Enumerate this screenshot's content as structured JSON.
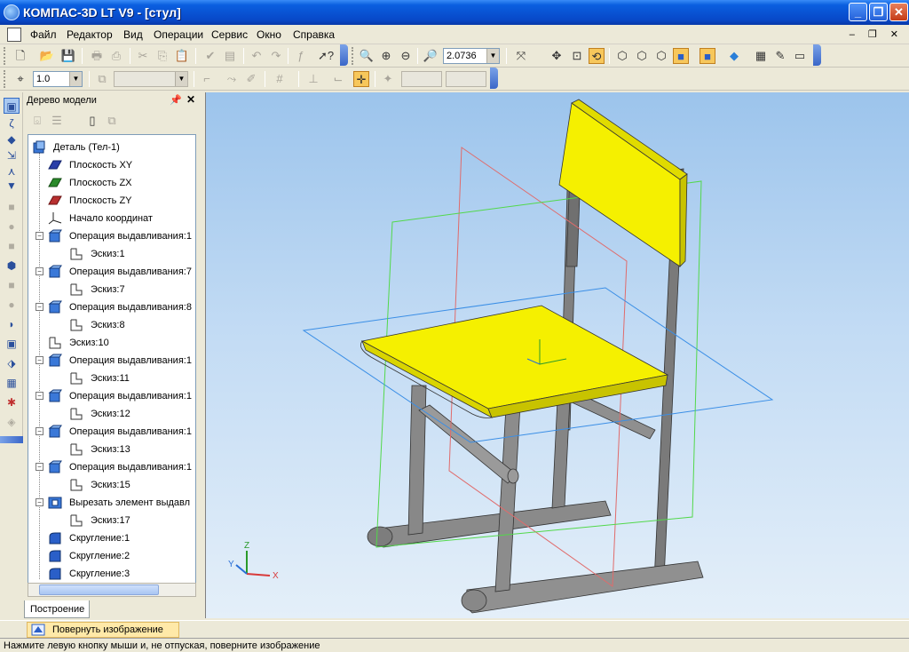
{
  "window": {
    "title": "КОМПАС-3D LT V9 - [стул]",
    "minimize": "_",
    "maximize": "❐",
    "close": "✕"
  },
  "menu": {
    "items": [
      "Файл",
      "Редактор",
      "Вид",
      "Операции",
      "Сервис",
      "Окно",
      "Справка"
    ],
    "mdi_buttons": "– ❐ ✕"
  },
  "toolbar1": {
    "zoom_value": "2.0736"
  },
  "toolbar2": {
    "step_value": "1.0"
  },
  "model_tree": {
    "title": "Дерево модели",
    "pin_icon": "pin-icon",
    "close": "✕",
    "items": [
      {
        "label": "Деталь (Тел-1)",
        "icon": "part-icon"
      },
      {
        "label": "Плоскость XY",
        "icon": "plane-xy-icon"
      },
      {
        "label": "Плоскость ZX",
        "icon": "plane-zx-icon"
      },
      {
        "label": "Плоскость ZY",
        "icon": "plane-zy-icon"
      },
      {
        "label": "Начало координат",
        "icon": "origin-icon"
      },
      {
        "label": "Операция выдавливания:1",
        "icon": "extrude-icon"
      },
      {
        "label": "Эскиз:1",
        "icon": "sketch-icon"
      },
      {
        "label": "Операция выдавливания:7",
        "icon": "extrude-icon"
      },
      {
        "label": "Эскиз:7",
        "icon": "sketch-icon"
      },
      {
        "label": "Операция выдавливания:8",
        "icon": "extrude-icon"
      },
      {
        "label": "Эскиз:8",
        "icon": "sketch-icon"
      },
      {
        "label": "Эскиз:10",
        "icon": "sketch-icon"
      },
      {
        "label": "Операция выдавливания:1",
        "icon": "extrude-icon"
      },
      {
        "label": "Эскиз:11",
        "icon": "sketch-icon"
      },
      {
        "label": "Операция выдавливания:1",
        "icon": "extrude-icon"
      },
      {
        "label": "Эскиз:12",
        "icon": "sketch-icon"
      },
      {
        "label": "Операция выдавливания:1",
        "icon": "extrude-icon"
      },
      {
        "label": "Эскиз:13",
        "icon": "sketch-icon"
      },
      {
        "label": "Операция выдавливания:1",
        "icon": "extrude-icon"
      },
      {
        "label": "Эскиз:15",
        "icon": "sketch-icon"
      },
      {
        "label": "Вырезать элемент выдавл",
        "icon": "cut-extrude-icon"
      },
      {
        "label": "Эскиз:17",
        "icon": "sketch-icon"
      },
      {
        "label": "Скругление:1",
        "icon": "fillet-icon"
      },
      {
        "label": "Скругление:2",
        "icon": "fillet-icon"
      },
      {
        "label": "Скругление:3",
        "icon": "fillet-icon"
      }
    ],
    "tab": "Построение"
  },
  "viewport": {
    "axis_labels": {
      "x": "X",
      "y": "Y",
      "z": "Z"
    }
  },
  "hint": {
    "label": "Повернуть изображение"
  },
  "status": {
    "text": "Нажмите левую кнопку мыши и, не отпуская, поверните изображение"
  },
  "colors": {
    "seat": "#f5f000",
    "frame": "#7f7f7f",
    "plane_xy": "#3a8ee6",
    "plane_zx": "#52d84a",
    "plane_zy": "#e06b6b"
  }
}
